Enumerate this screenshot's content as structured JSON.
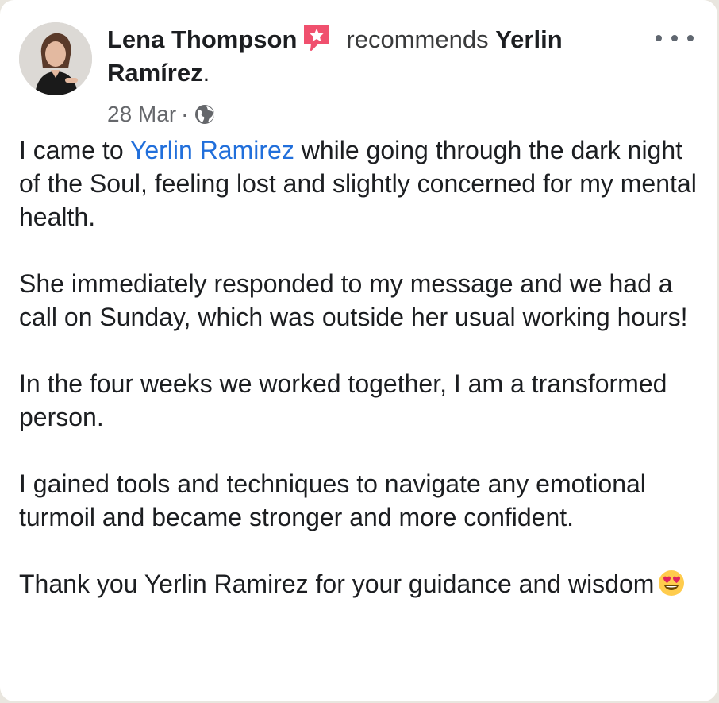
{
  "post": {
    "author": "Lena Thompson",
    "action": "recommends",
    "target": "Yerlin",
    "target_line2": "Ramírez",
    "target_punct": ".",
    "date": "28 Mar",
    "separator": "·",
    "audience_icon": "globe-icon",
    "badge_icon": "recommend-star-icon",
    "paragraphs": {
      "p1_mention": "Yerlin Ramirez",
      "p1_rest": " while going through the dark night of the Soul, feeling lost and slightly concerned for my mental health.",
      "p1_start": "I came to ",
      "p2": "She immediately responded to my message and we had a call on Sunday, which was outside her usual working hours!",
      "p3": "In the four weeks we worked together, I am a transformed person.",
      "p4": "I gained tools and techniques to navigate any emotional turmoil and became stronger and more confident.",
      "p5": "Thank you Yerlin Ramirez for your guidance and wisdom"
    },
    "closing_emoji": "heart-eyes-emoji-icon"
  },
  "colors": {
    "text": "#1c1e21",
    "secondary": "#65676b",
    "link": "#216fdb",
    "badge": "#f0506e"
  }
}
